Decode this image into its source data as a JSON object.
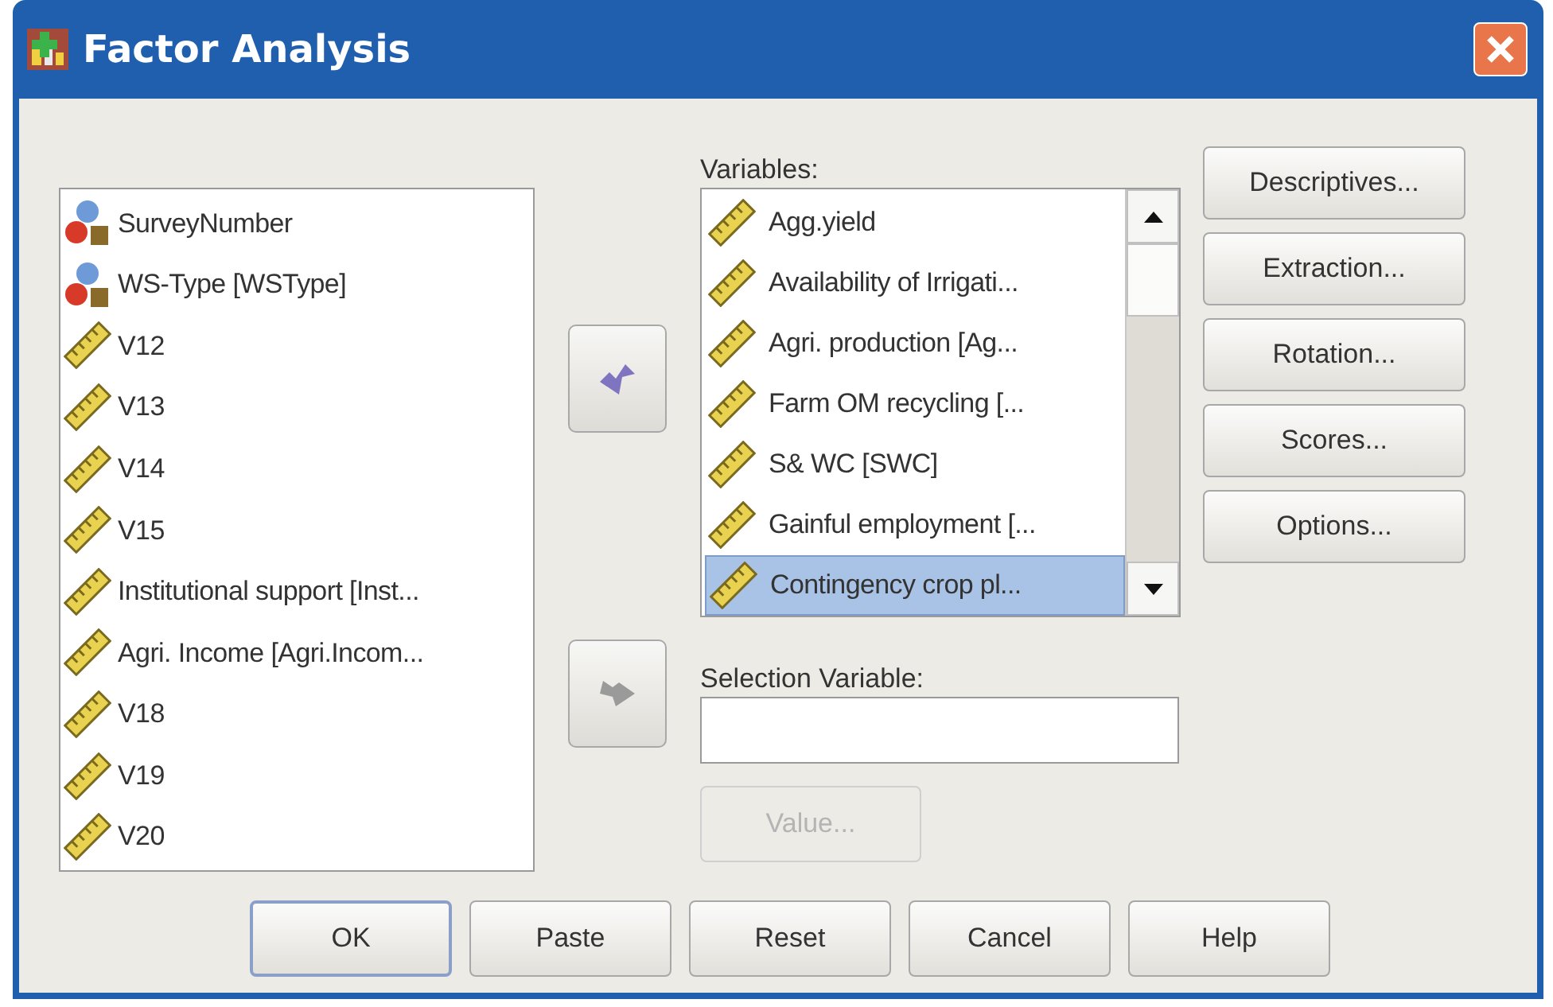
{
  "window": {
    "title": "Factor Analysis"
  },
  "source_list": [
    {
      "kind": "nominal",
      "label": "SurveyNumber"
    },
    {
      "kind": "nominal",
      "label": "WS-Type [WSType]"
    },
    {
      "kind": "scale",
      "label": "V12"
    },
    {
      "kind": "scale",
      "label": "V13"
    },
    {
      "kind": "scale",
      "label": "V14"
    },
    {
      "kind": "scale",
      "label": "V15"
    },
    {
      "kind": "scale",
      "label": "Institutional support [Inst..."
    },
    {
      "kind": "scale",
      "label": "Agri. Income [Agri.Incom..."
    },
    {
      "kind": "scale",
      "label": "V18"
    },
    {
      "kind": "scale",
      "label": "V19"
    },
    {
      "kind": "scale",
      "label": "V20"
    }
  ],
  "move_buttons": [
    {
      "kind": "back",
      "disabled": false
    },
    {
      "kind": "forward",
      "disabled": true
    }
  ],
  "variables": {
    "label": "Variables:",
    "items": [
      {
        "kind": "scale",
        "label": "Agg.yield",
        "selected": false
      },
      {
        "kind": "scale",
        "label": "Availability of Irrigati...",
        "selected": false
      },
      {
        "kind": "scale",
        "label": "Agri. production [Ag...",
        "selected": false
      },
      {
        "kind": "scale",
        "label": "Farm OM recycling [...",
        "selected": false
      },
      {
        "kind": "scale",
        "label": "S& WC [SWC]",
        "selected": false
      },
      {
        "kind": "scale",
        "label": "Gainful employment [...",
        "selected": false
      },
      {
        "kind": "scale",
        "label": "Contingency crop pl...",
        "selected": true
      }
    ]
  },
  "selection_variable": {
    "label": "Selection Variable:",
    "value_button": {
      "label": "Value...",
      "disabled": true
    }
  },
  "side_buttons": [
    "Descriptives...",
    "Extraction...",
    "Rotation...",
    "Scores...",
    "Options..."
  ],
  "bottom_buttons": [
    {
      "label": "OK",
      "default": true
    },
    {
      "label": "Paste",
      "default": false
    },
    {
      "label": "Reset",
      "default": false
    },
    {
      "label": "Cancel",
      "default": false
    },
    {
      "label": "Help",
      "default": false
    }
  ]
}
